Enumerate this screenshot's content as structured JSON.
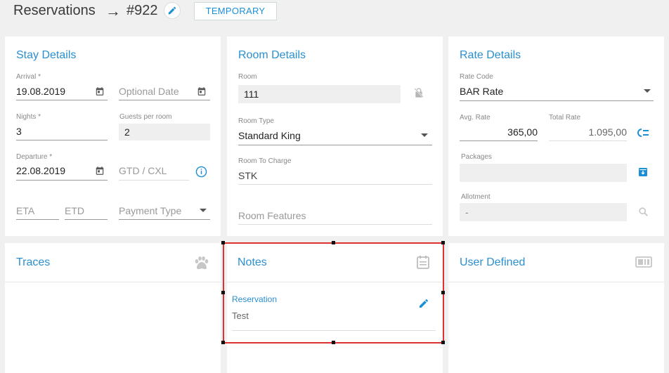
{
  "header": {
    "title": "Reservations",
    "arrow": "→",
    "reservation_number": "#922",
    "status_button": "TEMPORARY"
  },
  "stay": {
    "title": "Stay Details",
    "arrival_label": "Arrival *",
    "arrival_value": "19.08.2019",
    "optional_date_placeholder": "Optional Date",
    "nights_label": "Nights *",
    "nights_value": "3",
    "guests_label": "Guests per room",
    "guests_value": "2",
    "departure_label": "Departure *",
    "departure_value": "22.08.2019",
    "gtd_placeholder": "GTD / CXL",
    "eta_placeholder": "ETA",
    "etd_placeholder": "ETD",
    "payment_placeholder": "Payment Type"
  },
  "room": {
    "title": "Room Details",
    "room_label": "Room",
    "room_value": "111",
    "room_type_label": "Room Type",
    "room_type_value": "Standard King",
    "room_charge_label": "Room To Charge",
    "room_charge_value": "STK",
    "room_features_placeholder": "Room Features"
  },
  "rate": {
    "title": "Rate Details",
    "rate_code_label": "Rate Code",
    "rate_code_value": "BAR Rate",
    "avg_rate_label": "Avg. Rate",
    "avg_rate_value": "365,00",
    "total_rate_label": "Total Rate",
    "total_rate_value": "1.095,00",
    "packages_label": "Packages",
    "allotment_label": "Allotment",
    "allotment_value": "-"
  },
  "traces": {
    "title": "Traces"
  },
  "notes": {
    "title": "Notes",
    "note_label": "Reservation",
    "note_text": "Test"
  },
  "user_defined": {
    "title": "User Defined"
  },
  "colors": {
    "accent": "#2a8fd0",
    "highlight": "#e03131",
    "background": "#f0f0f0"
  }
}
